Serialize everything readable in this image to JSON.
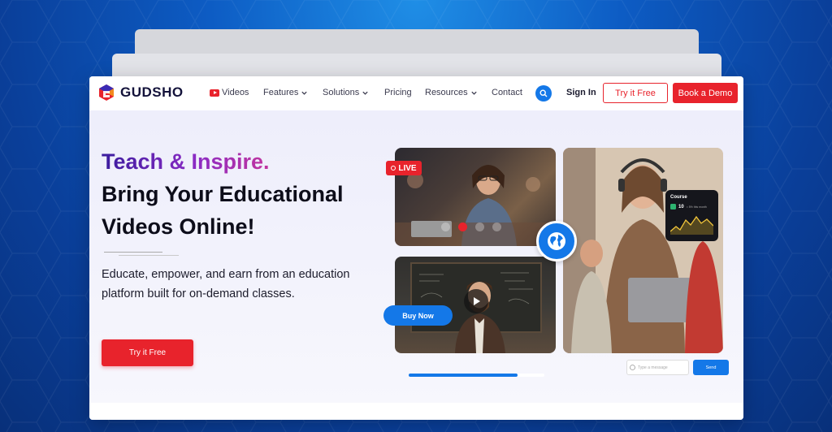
{
  "brand": {
    "name": "GUDSHO"
  },
  "nav": {
    "items": [
      {
        "label": "Videos",
        "has_icon": true
      },
      {
        "label": "Features",
        "has_dropdown": true
      },
      {
        "label": "Solutions",
        "has_dropdown": true
      },
      {
        "label": "Pricing"
      },
      {
        "label": "Resources",
        "has_dropdown": true
      },
      {
        "label": "Contact"
      }
    ],
    "signin_label": "Sign In",
    "try_label": "Try it Free",
    "demo_label": "Book a Demo"
  },
  "hero": {
    "headline_accent": "Teach & Inspire.",
    "headline_line2": "Bring Your Educational",
    "headline_line3": "Videos Online!",
    "subtext": "Educate, empower, and earn from an education platform built for on-demand classes.",
    "cta_label": "Try it Free"
  },
  "media": {
    "live_label": "LIVE",
    "buy_now_label": "Buy Now",
    "course_card": {
      "title": "Course",
      "stat_value": "10",
      "stat_caption": "= 5% this month"
    },
    "message_placeholder": "Type a message",
    "send_label": "Send",
    "video_progress": 0.8
  },
  "colors": {
    "accent": "#e8232c",
    "primary": "#1478e8",
    "bg": "#0d5cc4"
  }
}
